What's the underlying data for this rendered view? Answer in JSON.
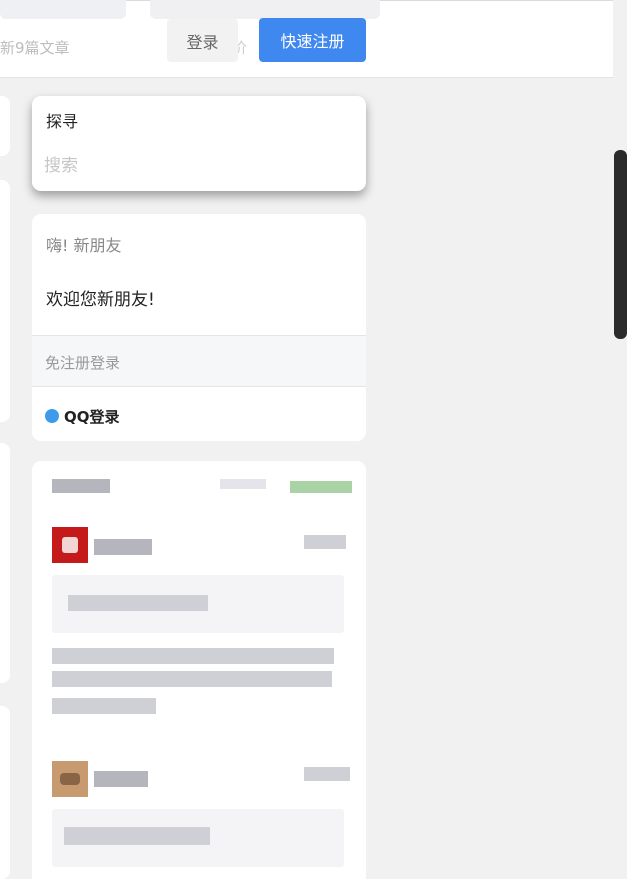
{
  "header": {
    "faded_text": "新9篇文章",
    "faded_text2": "价",
    "login_label": "登录",
    "register_label": "快速注册"
  },
  "search": {
    "title": "探寻",
    "placeholder": "搜索"
  },
  "welcome": {
    "greeting": "嗨! 新朋友",
    "message": "欢迎您新朋友!",
    "no_register_login": "免注册登录",
    "qq_login": "QQ登录"
  },
  "colors": {
    "accent": "#3f88f0",
    "qq": "#3d9be9"
  }
}
